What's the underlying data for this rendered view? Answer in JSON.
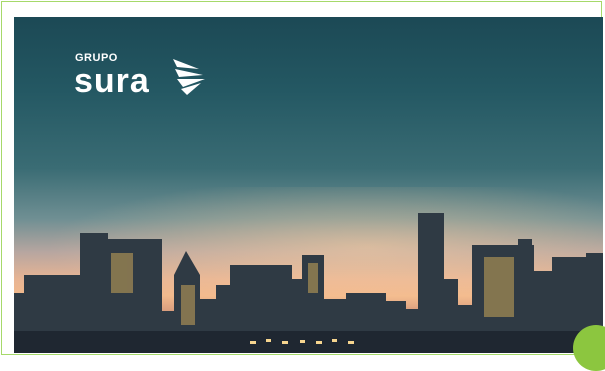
{
  "brand": {
    "small_text": "GRUPO",
    "big_text": "sura",
    "icon": "sura-wing-icon",
    "color": "#ffffff"
  },
  "colors": {
    "frame_border": "#a6d96a",
    "accent": "#8cc63f"
  }
}
